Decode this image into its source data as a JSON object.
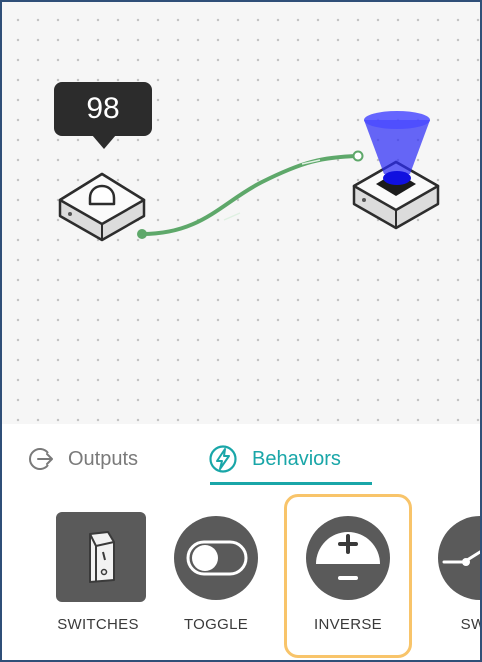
{
  "node": {
    "value": "98"
  },
  "tabs": [
    {
      "label": "Outputs",
      "icon": "arrow-exit-icon",
      "active": false
    },
    {
      "label": "Behaviors",
      "icon": "lightning-icon",
      "active": true
    }
  ],
  "tiles": [
    {
      "label": "SWITCHES",
      "icon": "rocker-switch-icon"
    },
    {
      "label": "TOGGLE",
      "icon": "toggle-icon"
    },
    {
      "label": "INVERSE",
      "icon": "plus-minus-dial-icon",
      "selected": true
    },
    {
      "label": "SWIT",
      "icon": "switch-line-icon"
    }
  ],
  "colors": {
    "accent": "#19a6a8",
    "wire": "#5ea86a",
    "selection": "#f8c46a",
    "light": "#2d2df5"
  }
}
